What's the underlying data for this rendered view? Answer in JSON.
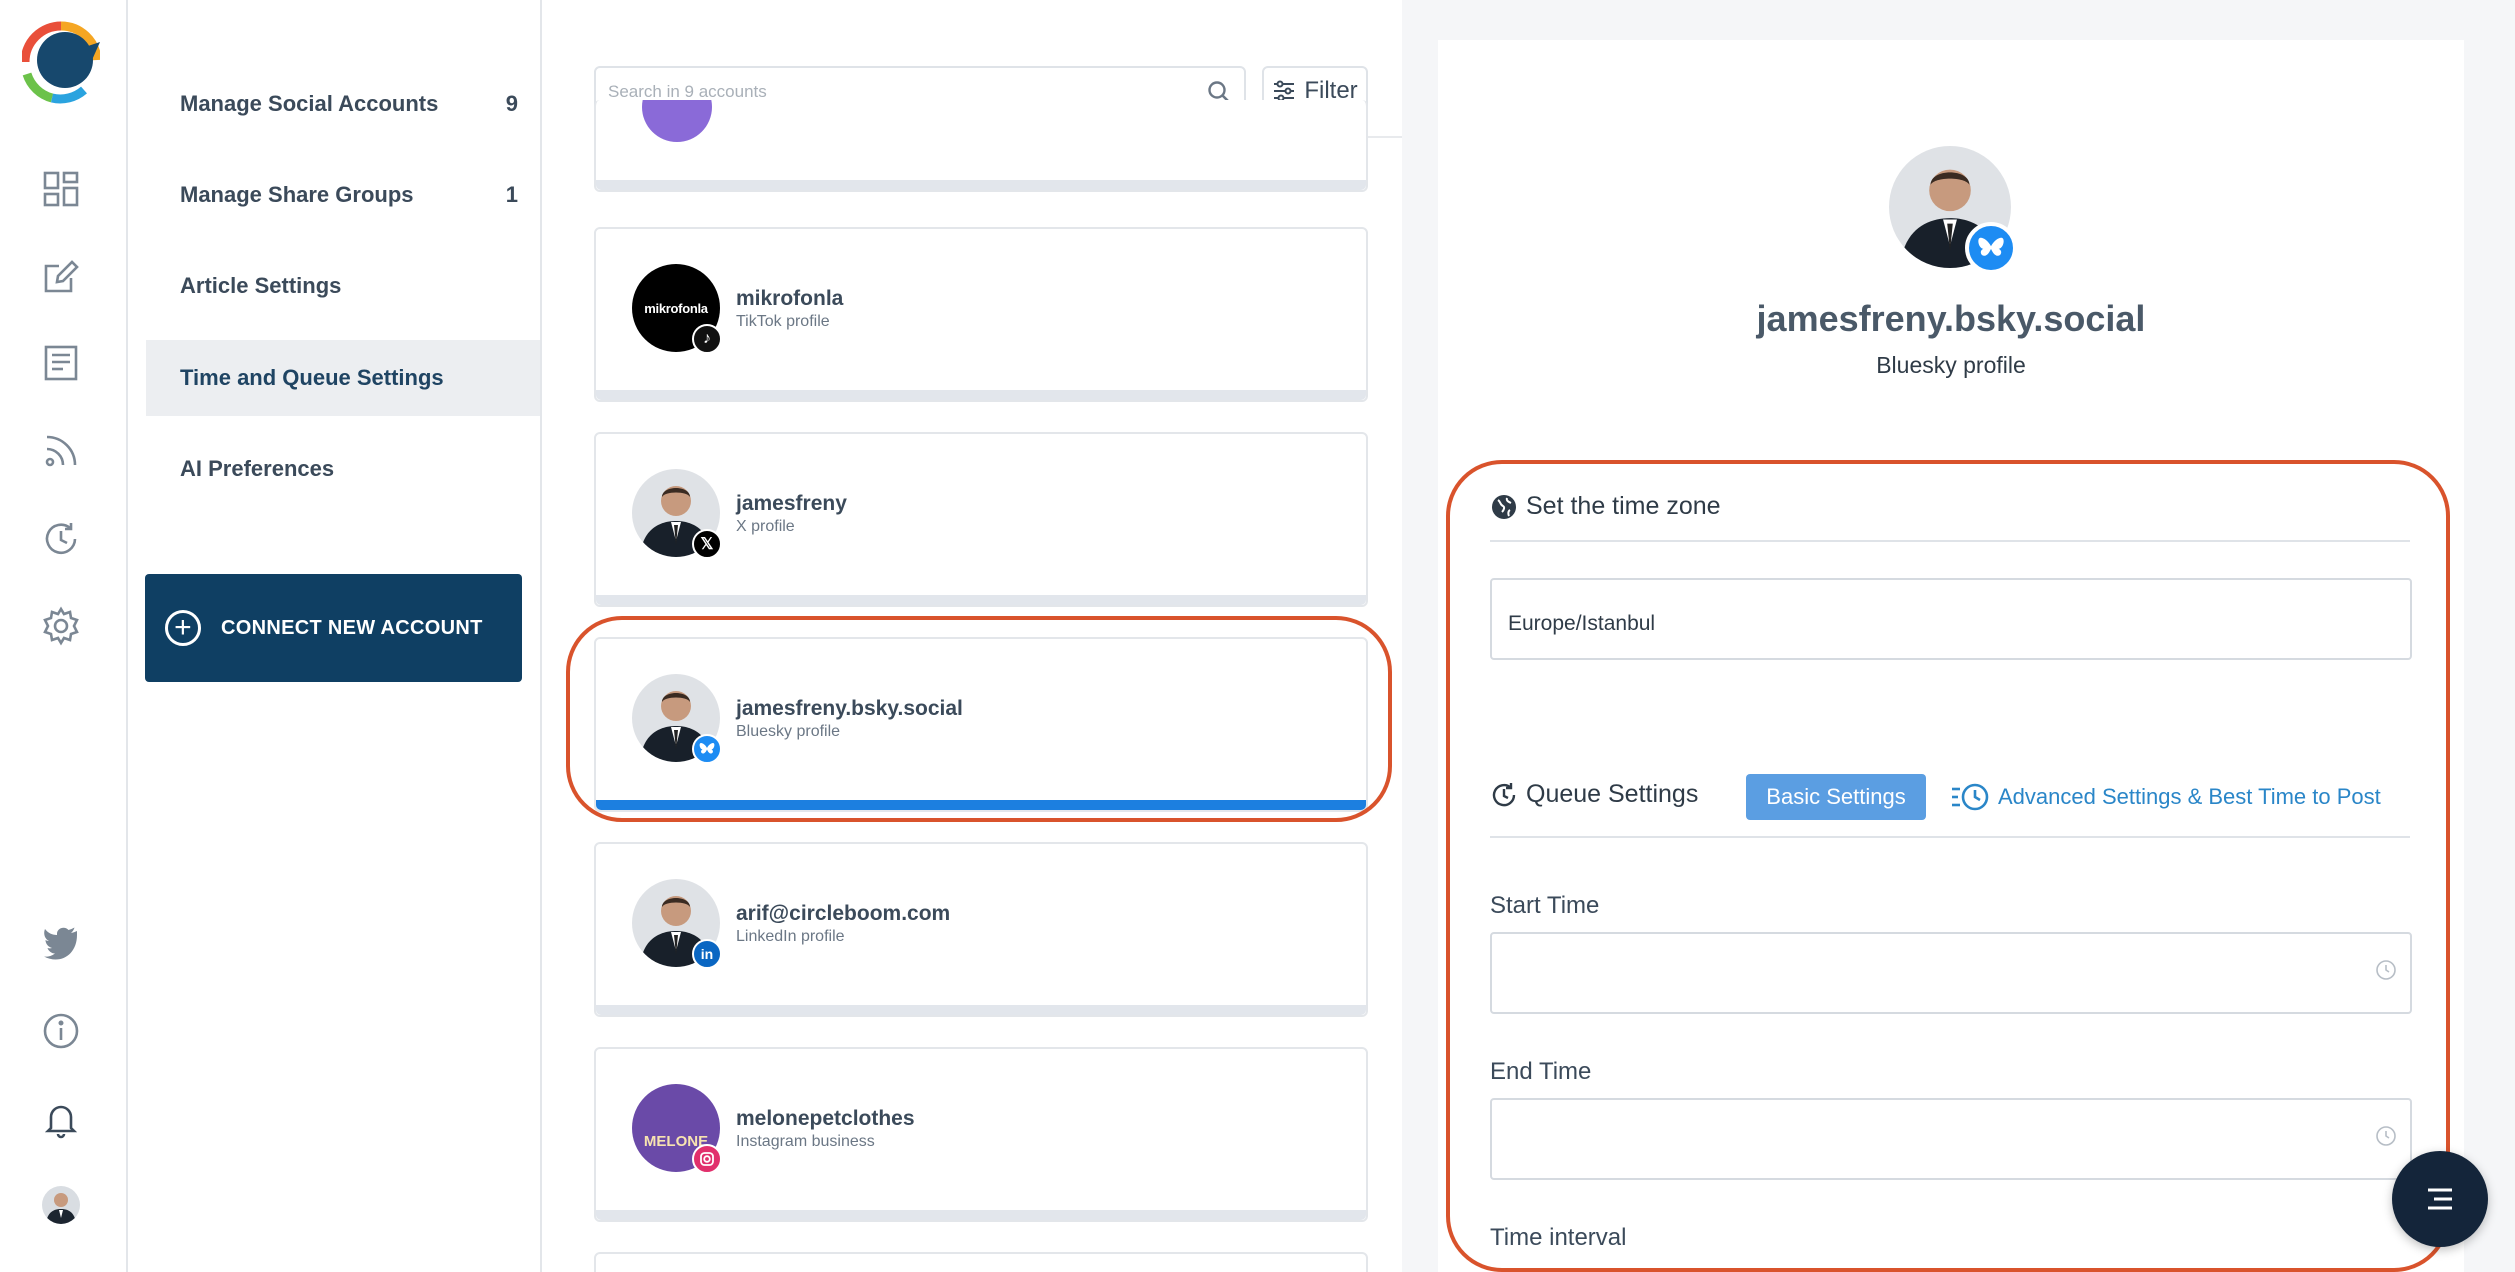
{
  "rail": {
    "icons": [
      "logo-icon",
      "dashboard-icon",
      "compose-icon",
      "articles-icon",
      "rss-icon",
      "queue-icon",
      "settings-icon",
      "twitter-icon",
      "info-icon",
      "bell-icon",
      "avatar"
    ]
  },
  "menu": {
    "items": [
      {
        "label": "Manage Social Accounts",
        "count": "9"
      },
      {
        "label": "Manage Share Groups",
        "count": "1"
      },
      {
        "label": "Article Settings",
        "count": ""
      },
      {
        "label": "Time and Queue Settings",
        "count": ""
      },
      {
        "label": "AI Preferences",
        "count": ""
      }
    ],
    "active_index": 3,
    "connect_label": "CONNECT NEW ACCOUNT"
  },
  "list": {
    "search_placeholder": "Search in 9 accounts",
    "filter_label": "Filter",
    "accounts": [
      {
        "name": "mikrofonla",
        "type": "TikTok profile",
        "network": "tiktok",
        "avatar_text": "mikrofonla"
      },
      {
        "name": "jamesfreny",
        "type": "X profile",
        "network": "x"
      },
      {
        "name": "jamesfreny.bsky.social",
        "type": "Bluesky profile",
        "network": "bluesky",
        "selected": true
      },
      {
        "name": "arif@circleboom.com",
        "type": "LinkedIn profile",
        "network": "linkedin"
      },
      {
        "name": "melonepetclothes",
        "type": "Instagram business",
        "network": "instagram",
        "avatar_text": "MELONE"
      }
    ]
  },
  "panel": {
    "profile_name": "jamesfreny.bsky.social",
    "profile_type": "Bluesky profile",
    "timezone": {
      "title": "Set the time zone",
      "value": "Europe/Istanbul"
    },
    "queue": {
      "title": "Queue Settings",
      "basic_label": "Basic Settings",
      "advanced_label": "Advanced Settings & Best Time to Post",
      "start_label": "Start Time",
      "start_value": "",
      "end_label": "End Time",
      "end_value": "",
      "interval_label": "Time interval"
    }
  },
  "colors": {
    "brand_navy": "#0f3f63",
    "highlight_ring": "#d9532c",
    "selected_bar": "#1c7fe0",
    "bluesky": "#1d8cf3",
    "link": "#2a86c8"
  }
}
